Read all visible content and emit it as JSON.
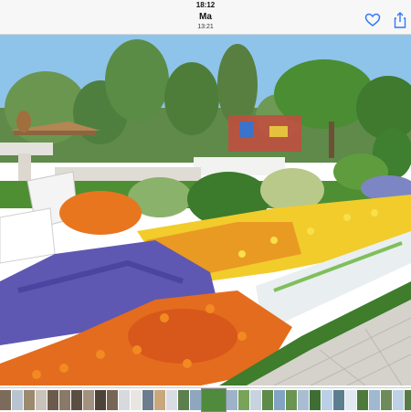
{
  "status_bar": {
    "time": "18:12"
  },
  "nav": {
    "title": "Ma",
    "subtitle": "13:21"
  },
  "icons": {
    "like": "heart-icon",
    "share": "share-icon"
  },
  "colors": {
    "accent": "#3478f6",
    "bar_bg": "#f7f7f7"
  },
  "thumbnails": {
    "count_visible": 34,
    "selected_index": 17,
    "colors": [
      "#7c6a5a",
      "#b8c4cf",
      "#9c8a6f",
      "#c9c2b8",
      "#6c5a4c",
      "#8a7968",
      "#5b4d40",
      "#a39180",
      "#4e4338",
      "#776655",
      "#d7d9dd",
      "#e8e6e0",
      "#6b7d8f",
      "#c8a77c",
      "#d9dde3",
      "#5d7f4e",
      "#8fa6c0",
      "#4f8a3d",
      "#9eb3c9",
      "#7aa35a",
      "#c7d3de",
      "#5e8b47",
      "#83a3c4",
      "#6a9450",
      "#a8bdd2",
      "#3f6e33",
      "#b9d0e6",
      "#5c7f8f",
      "#e0e9f1",
      "#4d7a3c",
      "#9fb9d1",
      "#6e8c5b",
      "#bcd1e3",
      "#577a46"
    ]
  }
}
